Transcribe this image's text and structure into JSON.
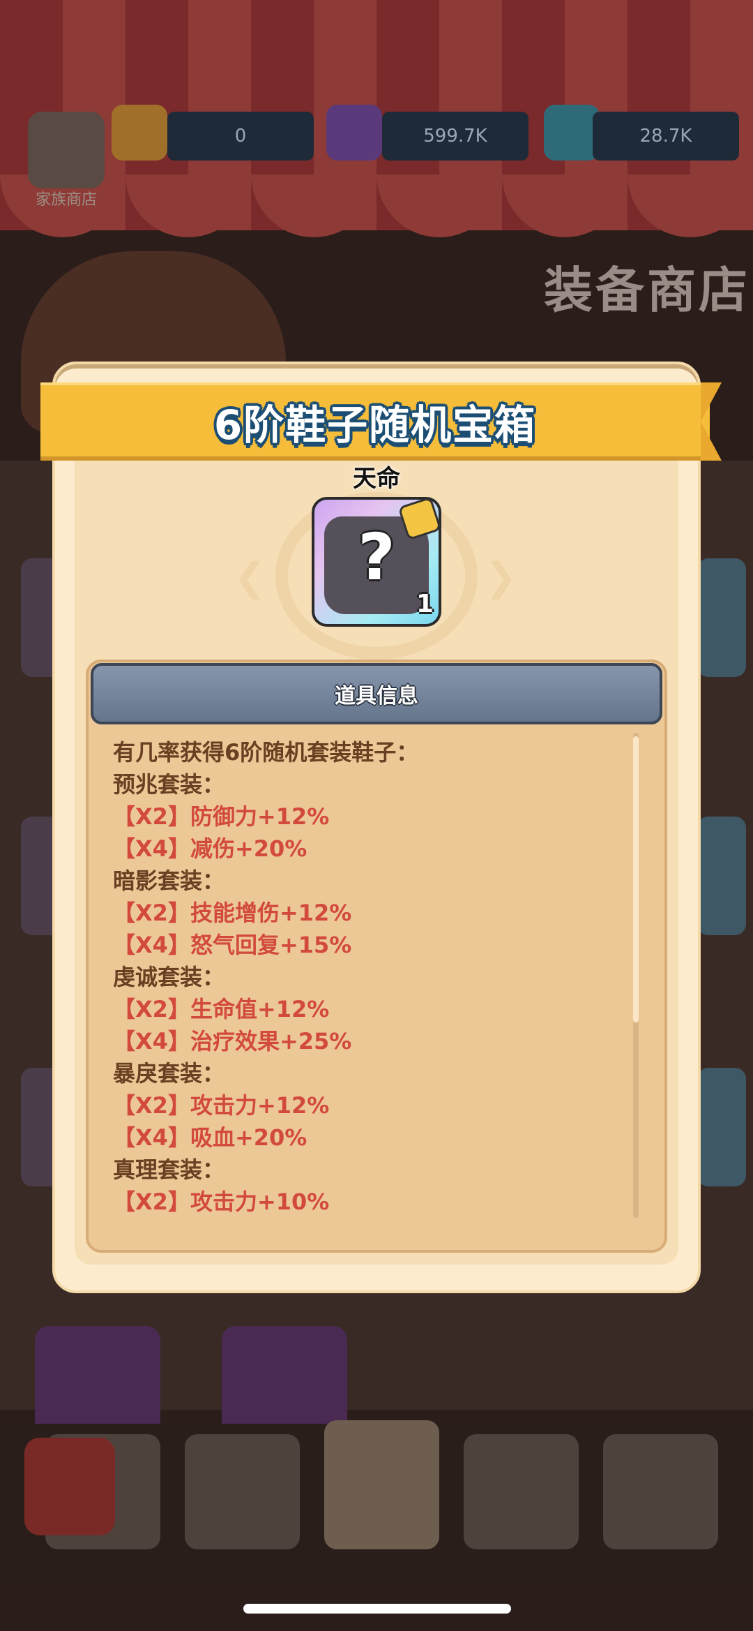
{
  "background": {
    "home_label": "家族商店",
    "resources": [
      "0",
      "599.7K",
      "28.7K"
    ],
    "shop_title": "装备商店"
  },
  "modal": {
    "title": "6阶鞋子随机宝箱",
    "subtitle": "天命",
    "item": {
      "icon": "mystery-boots-icon",
      "count": "1",
      "glyph": "?"
    },
    "info_header": "道具信息",
    "lines": [
      {
        "kind": "head",
        "text": "有几率获得6阶随机套装鞋子："
      },
      {
        "kind": "head",
        "text": "预兆套装："
      },
      {
        "kind": "bonus",
        "text": "【X2】防御力+12%"
      },
      {
        "kind": "bonus",
        "text": "【X4】减伤+20%"
      },
      {
        "kind": "head",
        "text": "暗影套装："
      },
      {
        "kind": "bonus",
        "text": "【X2】技能增伤+12%"
      },
      {
        "kind": "bonus",
        "text": "【X4】怒气回复+15%"
      },
      {
        "kind": "head",
        "text": "虔诚套装："
      },
      {
        "kind": "bonus",
        "text": "【X2】生命值+12%"
      },
      {
        "kind": "bonus",
        "text": "【X4】治疗效果+25%"
      },
      {
        "kind": "head",
        "text": "暴戾套装："
      },
      {
        "kind": "bonus",
        "text": "【X2】攻击力+12%"
      },
      {
        "kind": "bonus",
        "text": "【X4】吸血+20%"
      },
      {
        "kind": "head",
        "text": "真理套装："
      },
      {
        "kind": "bonus",
        "text": "【X2】攻击力+10%"
      }
    ]
  },
  "colors": {
    "ribbon": "#f5bd39",
    "title_outline": "#1c4e74",
    "set_heading": "#6a3f22",
    "set_bonus": "#d24a3c"
  }
}
